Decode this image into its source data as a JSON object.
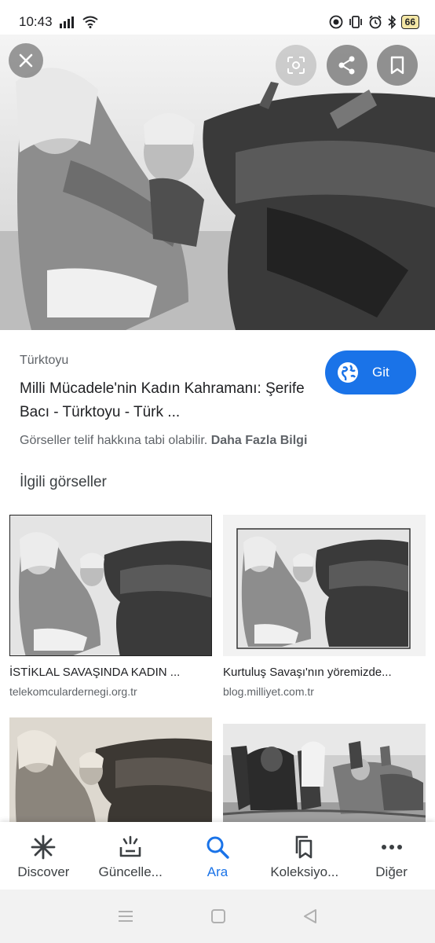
{
  "status_bar": {
    "time": "10:43",
    "battery": "66"
  },
  "hero": {
    "close_icon": "close-icon",
    "lens_icon": "lens-icon",
    "share_icon": "share-icon",
    "save_icon": "bookmark-icon"
  },
  "result": {
    "source": "Türktoyu",
    "title": "Milli Mücadele'nin Kadın Kahramanı: Şerife Bacı - Türktoyu - Türk ...",
    "go_label": "Git",
    "copyright_text": "Görseller telif hakkına tabi olabilir.",
    "more_info": "Daha Fazla Bilgi"
  },
  "related": {
    "heading": "İlgili görseller",
    "items": [
      {
        "caption": "İSTİKLAL SAVAŞINDA KADIN ...",
        "domain": "telekomculardernegi.org.tr"
      },
      {
        "caption": "Kurtuluş Savaşı'nın yöremizde...",
        "domain": "blog.milliyet.com.tr"
      },
      {
        "caption": "",
        "domain": ""
      },
      {
        "caption": "",
        "domain": ""
      }
    ]
  },
  "bottom_nav": {
    "items": [
      {
        "label": "Discover",
        "icon": "asterisk-icon"
      },
      {
        "label": "Güncelle...",
        "icon": "updates-icon"
      },
      {
        "label": "Ara",
        "icon": "search-icon"
      },
      {
        "label": "Koleksiyo...",
        "icon": "collections-icon"
      },
      {
        "label": "Diğer",
        "icon": "more-icon"
      }
    ],
    "active_color": "#1a73e8"
  }
}
